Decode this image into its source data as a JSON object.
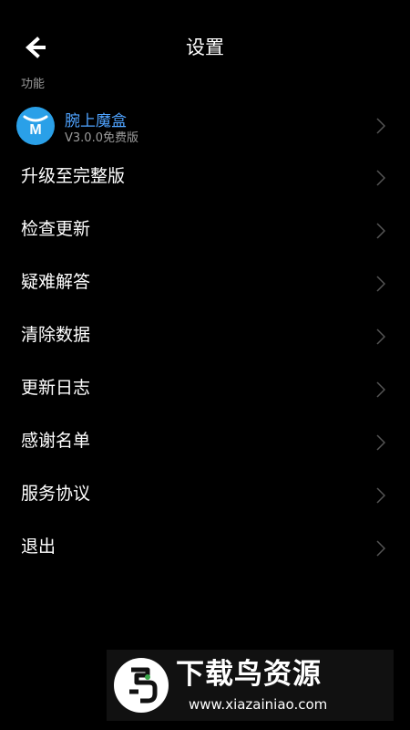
{
  "header": {
    "title": "设置",
    "back_icon": "back-arrow-icon"
  },
  "section": {
    "label": "功能"
  },
  "app": {
    "name": "腕上魔盒",
    "version": "V3.0.0免费版",
    "logo_letter": "M",
    "logo_color": "#2aa0e8"
  },
  "menu": {
    "items": [
      {
        "label": "升级至完整版"
      },
      {
        "label": "检查更新"
      },
      {
        "label": "疑难解答"
      },
      {
        "label": "清除数据"
      },
      {
        "label": "更新日志"
      },
      {
        "label": "感谢名单"
      },
      {
        "label": "服务协议"
      },
      {
        "label": "退出"
      }
    ]
  },
  "watermark": {
    "title": "下载鸟资源",
    "url": "www.xiazainiao.com"
  },
  "colors": {
    "background": "#000000",
    "accent": "#4fa3ff",
    "muted": "#9c9c9c",
    "chevron": "#555555"
  }
}
